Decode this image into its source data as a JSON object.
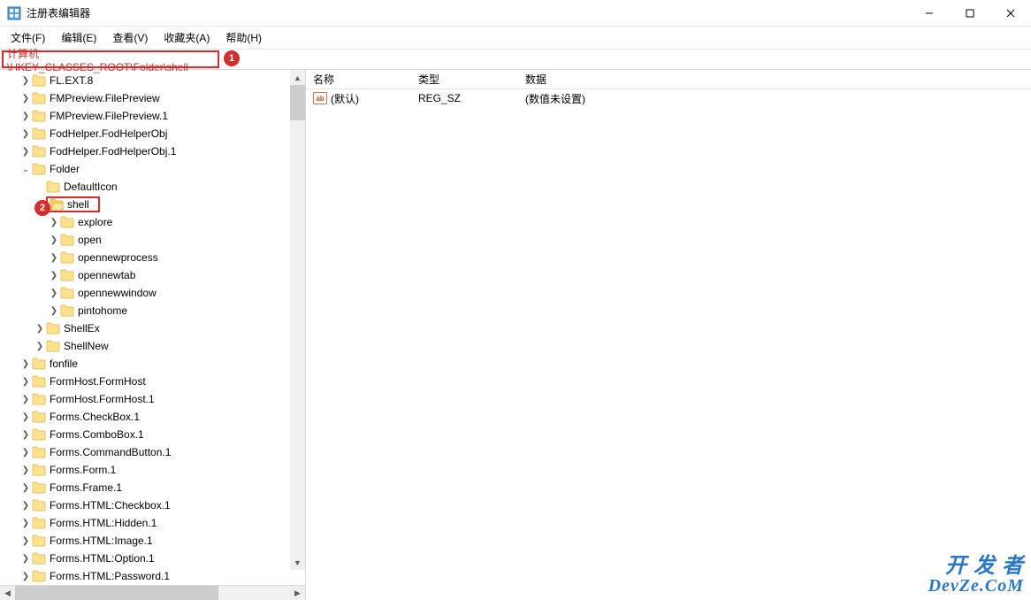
{
  "window": {
    "title": "注册表编辑器"
  },
  "menu": {
    "file": "文件(F)",
    "edit": "编辑(E)",
    "view": "查看(V)",
    "favorites": "收藏夹(A)",
    "help": "帮助(H)"
  },
  "addressbar": {
    "path": "计算机\\HKEY_CLASSES_ROOT\\Folder\\shell"
  },
  "annotations": {
    "badge1": "1",
    "badge2": "2"
  },
  "tree": [
    {
      "label": "FL.EXT.8",
      "level": 2,
      "exp": ">"
    },
    {
      "label": "FMPreview.FilePreview",
      "level": 2,
      "exp": ">"
    },
    {
      "label": "FMPreview.FilePreview.1",
      "level": 2,
      "exp": ">"
    },
    {
      "label": "FodHelper.FodHelperObj",
      "level": 2,
      "exp": ">"
    },
    {
      "label": "FodHelper.FodHelperObj.1",
      "level": 2,
      "exp": ">"
    },
    {
      "label": "Folder",
      "level": 2,
      "exp": "v"
    },
    {
      "label": "DefaultIcon",
      "level": 3,
      "exp": ""
    },
    {
      "label": "shell",
      "level": 3,
      "exp": "v",
      "selected": true,
      "openIcon": true
    },
    {
      "label": "explore",
      "level": 4,
      "exp": ">"
    },
    {
      "label": "open",
      "level": 4,
      "exp": ">"
    },
    {
      "label": "opennewprocess",
      "level": 4,
      "exp": ">"
    },
    {
      "label": "opennewtab",
      "level": 4,
      "exp": ">"
    },
    {
      "label": "opennewwindow",
      "level": 4,
      "exp": ">"
    },
    {
      "label": "pintohome",
      "level": 4,
      "exp": ">"
    },
    {
      "label": "ShellEx",
      "level": 3,
      "exp": ">"
    },
    {
      "label": "ShellNew",
      "level": 3,
      "exp": ">"
    },
    {
      "label": "fonfile",
      "level": 2,
      "exp": ">"
    },
    {
      "label": "FormHost.FormHost",
      "level": 2,
      "exp": ">"
    },
    {
      "label": "FormHost.FormHost.1",
      "level": 2,
      "exp": ">"
    },
    {
      "label": "Forms.CheckBox.1",
      "level": 2,
      "exp": ">"
    },
    {
      "label": "Forms.ComboBox.1",
      "level": 2,
      "exp": ">"
    },
    {
      "label": "Forms.CommandButton.1",
      "level": 2,
      "exp": ">"
    },
    {
      "label": "Forms.Form.1",
      "level": 2,
      "exp": ">"
    },
    {
      "label": "Forms.Frame.1",
      "level": 2,
      "exp": ">"
    },
    {
      "label": "Forms.HTML:Checkbox.1",
      "level": 2,
      "exp": ">"
    },
    {
      "label": "Forms.HTML:Hidden.1",
      "level": 2,
      "exp": ">"
    },
    {
      "label": "Forms.HTML:Image.1",
      "level": 2,
      "exp": ">"
    },
    {
      "label": "Forms.HTML:Option.1",
      "level": 2,
      "exp": ">"
    },
    {
      "label": "Forms.HTML:Password.1",
      "level": 2,
      "exp": ">"
    }
  ],
  "list": {
    "columns": {
      "name": "名称",
      "type": "类型",
      "data": "数据"
    },
    "rows": [
      {
        "icon": "ab",
        "name": "(默认)",
        "type": "REG_SZ",
        "data": "(数值未设置)"
      }
    ]
  },
  "watermark": {
    "line1": "开 发 者",
    "line2": "DevZe.CoM"
  }
}
